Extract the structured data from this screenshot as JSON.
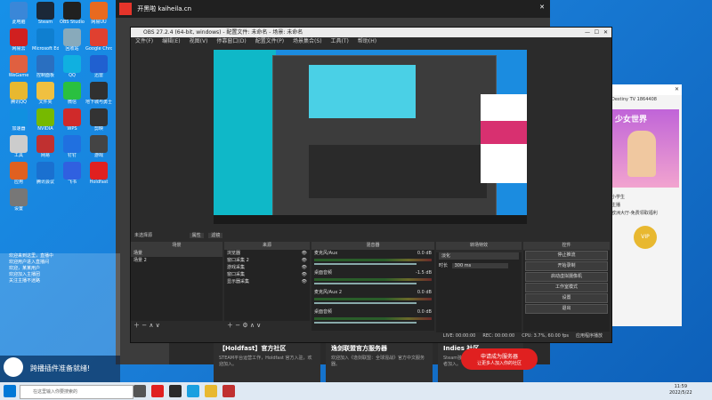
{
  "desktop": {
    "icons": [
      {
        "label": "此电脑"
      },
      {
        "label": "Steam"
      },
      {
        "label": "OBS Studio"
      },
      {
        "label": "网易UU"
      },
      {
        "label": "网易云"
      },
      {
        "label": "Microsoft Edge"
      },
      {
        "label": "回收站"
      },
      {
        "label": "Google Chrome"
      },
      {
        "label": "WeGame"
      },
      {
        "label": "控制面板"
      },
      {
        "label": "QQ"
      },
      {
        "label": "迅雷"
      },
      {
        "label": "腾讯QQ"
      },
      {
        "label": "文件夹"
      },
      {
        "label": "微信"
      },
      {
        "label": "地下城与勇士"
      },
      {
        "label": "加速器"
      },
      {
        "label": "NVIDIA"
      },
      {
        "label": "WPS"
      },
      {
        "label": "剪映"
      },
      {
        "label": "工具"
      },
      {
        "label": "网易"
      },
      {
        "label": "钉钉"
      },
      {
        "label": "游戏"
      },
      {
        "label": "应用"
      },
      {
        "label": "腾讯会议"
      },
      {
        "label": "飞书"
      },
      {
        "label": "Holdfast"
      },
      {
        "label": "设置"
      }
    ]
  },
  "browser": {
    "title": "开黑啦 kaiheila.cn",
    "cards": [
      {
        "title": "【Holdfast】官方社区",
        "desc": "STEAM平台运营工作，Holdfast 官方入驻，欢迎加入。"
      },
      {
        "title": "逸剑联盟官方服务器",
        "desc": "欢迎加入《逸剑联盟：全球混战》官方中文服务器。"
      },
      {
        "title": "Indies 社区",
        "desc": "Steam独游社区，欢迎独立游戏爱好者加入。"
      }
    ],
    "notice": {
      "title": "申请成为服务器",
      "sub": "让更多人加入你的社区"
    }
  },
  "obs": {
    "title": "OBS 27.2.4 (64-bit, windows) - 配置文件: 未命名 - 场景: 未命名",
    "menu": [
      "文件(F)",
      "编辑(E)",
      "视图(V)",
      "停靠窗口(D)",
      "配置文件(P)",
      "场景集合(S)",
      "工具(T)",
      "帮助(H)"
    ],
    "filter_label": "未选择源",
    "props_button": "属性",
    "filters_button": "滤镜",
    "panels": {
      "scenes": {
        "header": "场景",
        "items": [
          "场景",
          "场景 2"
        ]
      },
      "sources": {
        "header": "来源",
        "items": [
          "浏览器",
          "窗口采集 2",
          "游戏采集",
          "窗口采集",
          "显示器采集"
        ]
      },
      "mixer": {
        "header": "混音器",
        "channels": [
          {
            "name": "麦克风/Aux",
            "db": "0.0 dB"
          },
          {
            "name": "桌面音频",
            "db": "-1.5 dB"
          },
          {
            "name": "麦克风/Aux 2",
            "db": "0.0 dB"
          },
          {
            "name": "桌面音频",
            "db": "0.0 dB"
          }
        ]
      },
      "transitions": {
        "header": "转场特效",
        "mode": "淡化",
        "duration_label": "时长",
        "duration": "300 ms"
      },
      "controls": {
        "header": "控件",
        "buttons": [
          "停止推流",
          "开始录制",
          "启动虚拟摄像机",
          "工作室模式",
          "设置",
          "退出"
        ]
      }
    },
    "status": [
      "LIVE: 00:00:00",
      "REC: 00:00:00",
      "CPU: 3.7%, 60.00 fps",
      "应用程序播放"
    ]
  },
  "chat": {
    "header": "Destiny TV 1864408",
    "poster_text": "少女世界",
    "items": [
      "小学生",
      "主播",
      "欧洲大厅-免费领取福利"
    ],
    "badge": "VIP"
  },
  "overlay": {
    "lines": [
      "欢迎来到这里，直播中",
      "欢迎用户进入直播间",
      "欢迎，某某用户",
      "欢迎加入主播团",
      "关注主播不迷路"
    ],
    "banner": "跨播插件准备就绪!"
  },
  "taskbar": {
    "search_placeholder": "在这里输入你要搜索的",
    "time": "11:59",
    "date": "2022/5/22"
  },
  "colors": {
    "accent": "#1a7fd9",
    "obs_bg": "#2b2b2b",
    "live_red": "#e02020"
  }
}
